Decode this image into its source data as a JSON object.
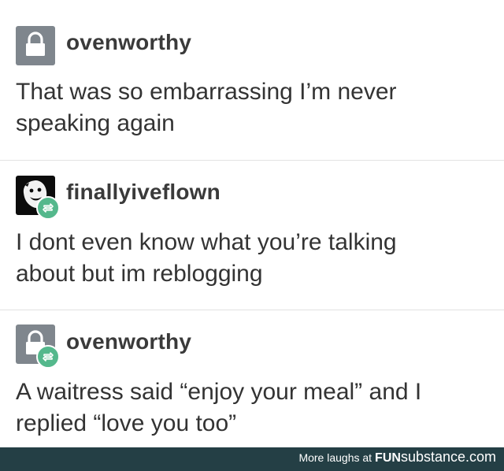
{
  "posts": [
    {
      "username": "ovenworthy",
      "text_line1": "That was so embarrassing I’m never",
      "text_line2": "speaking again",
      "avatar_icon": "lock-icon",
      "reblog": false
    },
    {
      "username": "finallyiveflown",
      "text_line1": "I dont even know what you’re talking",
      "text_line2": "about but im reblogging",
      "avatar_icon": "face-icon",
      "reblog": true
    },
    {
      "username": "ovenworthy",
      "text_line1": "A waitress said “enjoy your meal” and I",
      "text_line2": "replied “love you too”",
      "avatar_icon": "lock-icon",
      "reblog": true
    }
  ],
  "footer": {
    "prefix": "More laughs at",
    "brand_bold": "FUN",
    "brand_rest": "substance.com"
  },
  "colors": {
    "reblog_badge": "#54b88c",
    "footer_bg": "#243f45",
    "lock_avatar_bg": "#7f868d"
  }
}
